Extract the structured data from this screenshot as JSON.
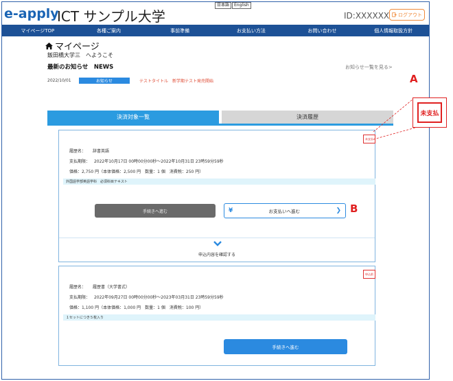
{
  "header": {
    "logo": "e-apply",
    "site_title": "ICT サンプル大学",
    "lang_ja": "日本語",
    "lang_en": "English",
    "user_id": "ID:XXXXXX",
    "logout_label": "ログアウト"
  },
  "nav": {
    "items": [
      "マイページTOP",
      "各種ご案内",
      "事前準備",
      "お支払い方法",
      "お問い合わせ",
      "個人情報取扱方針"
    ]
  },
  "mypage": {
    "title": "マイページ",
    "welcome": "飯田橋大学三　へようこそ"
  },
  "news": {
    "heading": "最新のお知らせ　NEWS",
    "more_link": "お知らせ一覧を見る>",
    "items": [
      {
        "date": "2022/10/01",
        "badge": "お知らせ",
        "text": "テストタイトル　新学期テスト発売開始"
      }
    ]
  },
  "tabs": {
    "active": "決済対象一覧",
    "inactive": "決済履歴"
  },
  "cards": [
    {
      "stamp": "未支払",
      "name_label": "履歴名：",
      "name_value": "辞書英語",
      "period_label": "支払期限：",
      "period_value": "2022年10月17日 00時00分00秒～2022年10月31日 23時59分59秒",
      "price_line": "価格：2,750 円（本体価格：2,500 円　数量：1 個　消費税：250 円）",
      "hint": "外国語学部英語学科　必須科目テキスト",
      "proceed_label": "手続きへ進む",
      "pay_symbol": "¥",
      "pay_label": "お支払いへ進む",
      "pay_chevron": "❯",
      "confirm_label": "申込内容を確認する"
    },
    {
      "stamp": "申込前",
      "name_label": "履歴名：",
      "name_value": "履歴書（大学書式）",
      "period_label": "支払期限：",
      "period_value": "2022年09月27日 00時00分00秒～2023年03月31日 23時59分59秒",
      "price_line": "価格：1,100 円（本体価格：1,000 円　数量：1 個　消費税：100 円）",
      "hint": "１セットにつき５枚入り",
      "proceed_label": "手続きへ進む"
    }
  ],
  "annotations": {
    "a_label": "A",
    "b_label": "B",
    "callout_text": "未支払",
    "color": "#e02020"
  },
  "colors": {
    "brand": "#1a64b4",
    "nav": "#1d5196",
    "accent": "#2b8ae0",
    "logout": "#f08a3a"
  }
}
